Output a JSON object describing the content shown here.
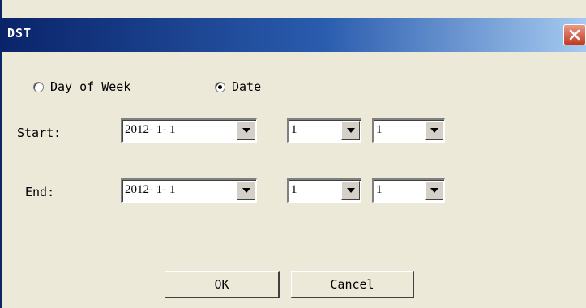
{
  "window": {
    "title": "DST"
  },
  "mode": {
    "options": [
      {
        "label": "Day of Week",
        "selected": false
      },
      {
        "label": "Date",
        "selected": true
      }
    ]
  },
  "start": {
    "label": "Start:",
    "date": "2012- 1- 1",
    "field2": "1",
    "field3": "1"
  },
  "end": {
    "label": "End:",
    "date": "2012- 1- 1",
    "field2": "1",
    "field3": "1"
  },
  "buttons": {
    "ok": "OK",
    "cancel": "Cancel"
  },
  "colors": {
    "titlebar_start": "#0a246a",
    "titlebar_end": "#a6caf0",
    "close_button": "#c4391f",
    "dialog_bg": "#ece9d8"
  }
}
